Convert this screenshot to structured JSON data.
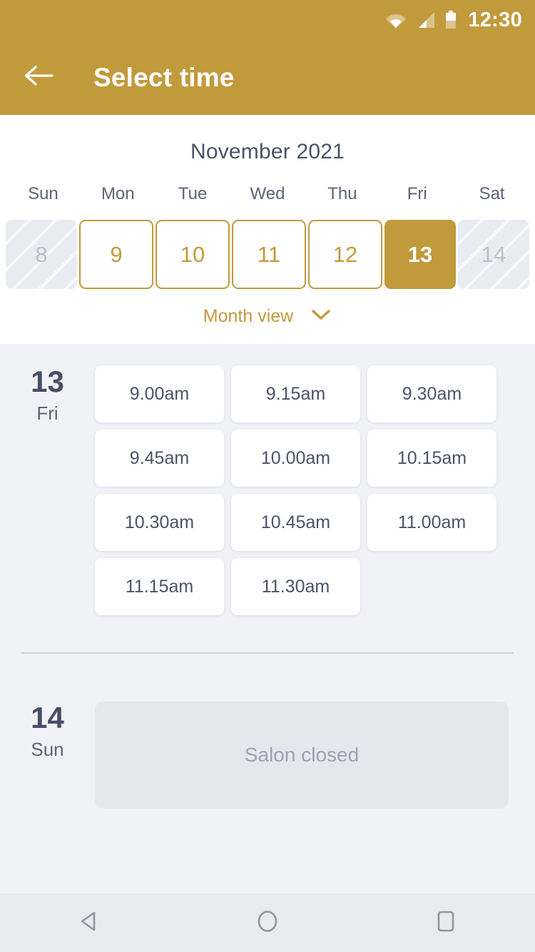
{
  "status_bar": {
    "time": "12:30",
    "icons": [
      "wifi-icon",
      "cellular-signal-icon",
      "battery-icon"
    ]
  },
  "app_bar": {
    "title": "Select time",
    "back_icon": "back-arrow-icon"
  },
  "calendar": {
    "month_title": "November 2021",
    "weekday_headers": [
      "Sun",
      "Mon",
      "Tue",
      "Wed",
      "Thu",
      "Fri",
      "Sat"
    ],
    "days": [
      {
        "num": "8",
        "state": "disabled"
      },
      {
        "num": "9",
        "state": "available"
      },
      {
        "num": "10",
        "state": "available"
      },
      {
        "num": "11",
        "state": "available"
      },
      {
        "num": "12",
        "state": "available"
      },
      {
        "num": "13",
        "state": "selected"
      },
      {
        "num": "14",
        "state": "disabled"
      }
    ],
    "month_view_label": "Month view",
    "month_view_icon": "chevron-down-icon"
  },
  "schedule": [
    {
      "day_number": "13",
      "day_name": "Fri",
      "slots": [
        "9.00am",
        "9.15am",
        "9.30am",
        "9.45am",
        "10.00am",
        "10.15am",
        "10.30am",
        "10.45am",
        "11.00am",
        "11.15am",
        "11.30am"
      ],
      "closed_message": null
    },
    {
      "day_number": "14",
      "day_name": "Sun",
      "slots": [],
      "closed_message": "Salon closed"
    }
  ],
  "nav_bar": {
    "back_icon": "nav-back-triangle-icon",
    "home_icon": "nav-home-circle-icon",
    "recents_icon": "nav-recents-square-icon"
  },
  "colors": {
    "brand_gold": "#C19A3C",
    "app_background": "#F0F2F7",
    "calendar_background": "#FFFFFF",
    "text_dark": "#474F66",
    "text_muted": "#5B6479",
    "disabled_text": "#B9C0CC",
    "closed_card": "#E4E8EE",
    "nav_background": "#E7EAEF"
  }
}
